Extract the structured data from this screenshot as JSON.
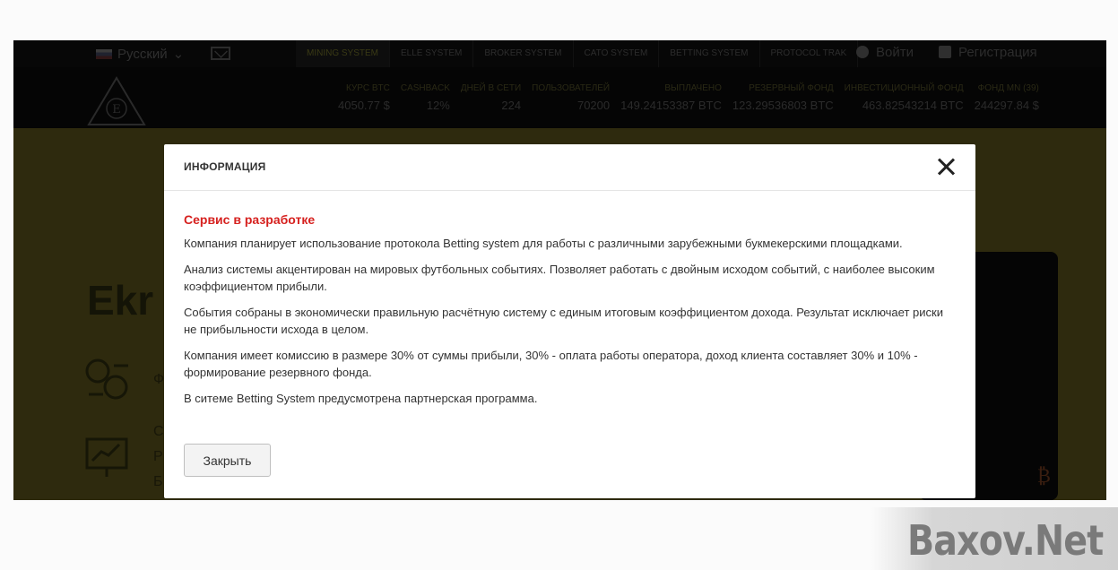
{
  "topnav": {
    "language": "Русский",
    "tabs": [
      "MINING SYSTEM",
      "ELLE SYSTEM",
      "BROKER SYSTEM",
      "CATO SYSTEM",
      "BETTING SYSTEM",
      "PROTOCOL TRAK"
    ],
    "login": "Войти",
    "register": "Регистрация"
  },
  "stats": [
    {
      "label": "КУРС BTC",
      "value": "4050.77 $"
    },
    {
      "label": "CASHBACK",
      "value": "12%"
    },
    {
      "label": "ДНЕЙ В СЕТИ",
      "value": "224"
    },
    {
      "label": "ПОЛЬЗОВАТЕЛЕЙ",
      "value": "70200"
    },
    {
      "label": "ВЫПЛАЧЕНО",
      "value": "149.24153387 BTC"
    },
    {
      "label": "РЕЗЕРВНЫЙ ФОНД",
      "value": "123.29536803 BTC"
    },
    {
      "label": "ИНВЕСТИЦИОННЫЙ ФОНД",
      "value": "463.82543214 BTC"
    },
    {
      "label": "ФОНД MN (39)",
      "value": "244297.84 $"
    }
  ],
  "hero": {
    "title_fragment": "Ekr",
    "logo_letter": "E",
    "letters": [
      "Ф",
      "С",
      "Р",
      "Б"
    ],
    "btc_symbol": "₿"
  },
  "modal": {
    "title": "ИНФОРМАЦИЯ",
    "subtitle": "Сервис в разработке",
    "paragraphs": [
      "Компания планирует использование протокола Betting system для работы с различными зарубежными букмекерскими площадками.",
      "Анализ системы акцентирован на мировых футбольных событиях. Позволяет работать с двойным исходом событий, с наиболее высоким коэффициентом прибыли.",
      "События собраны в экономически правильную расчётную систему с единым итоговым коэффициентом дохода. Результат исключает риски не прибыльности исхода в целом.",
      "Компания имеет комиссию в размере 30% от суммы прибыли, 30% - оплата работы оператора, доход клиента составляет 30% и 10% - формирование резервного фонда.",
      "В ситеме Betting System предусмотрена партнерская программа."
    ],
    "close_button": "Закрыть"
  },
  "watermark": "Baxov.Net",
  "colors": {
    "accent_red": "#d6211f",
    "overlay_dark": "#050505"
  }
}
